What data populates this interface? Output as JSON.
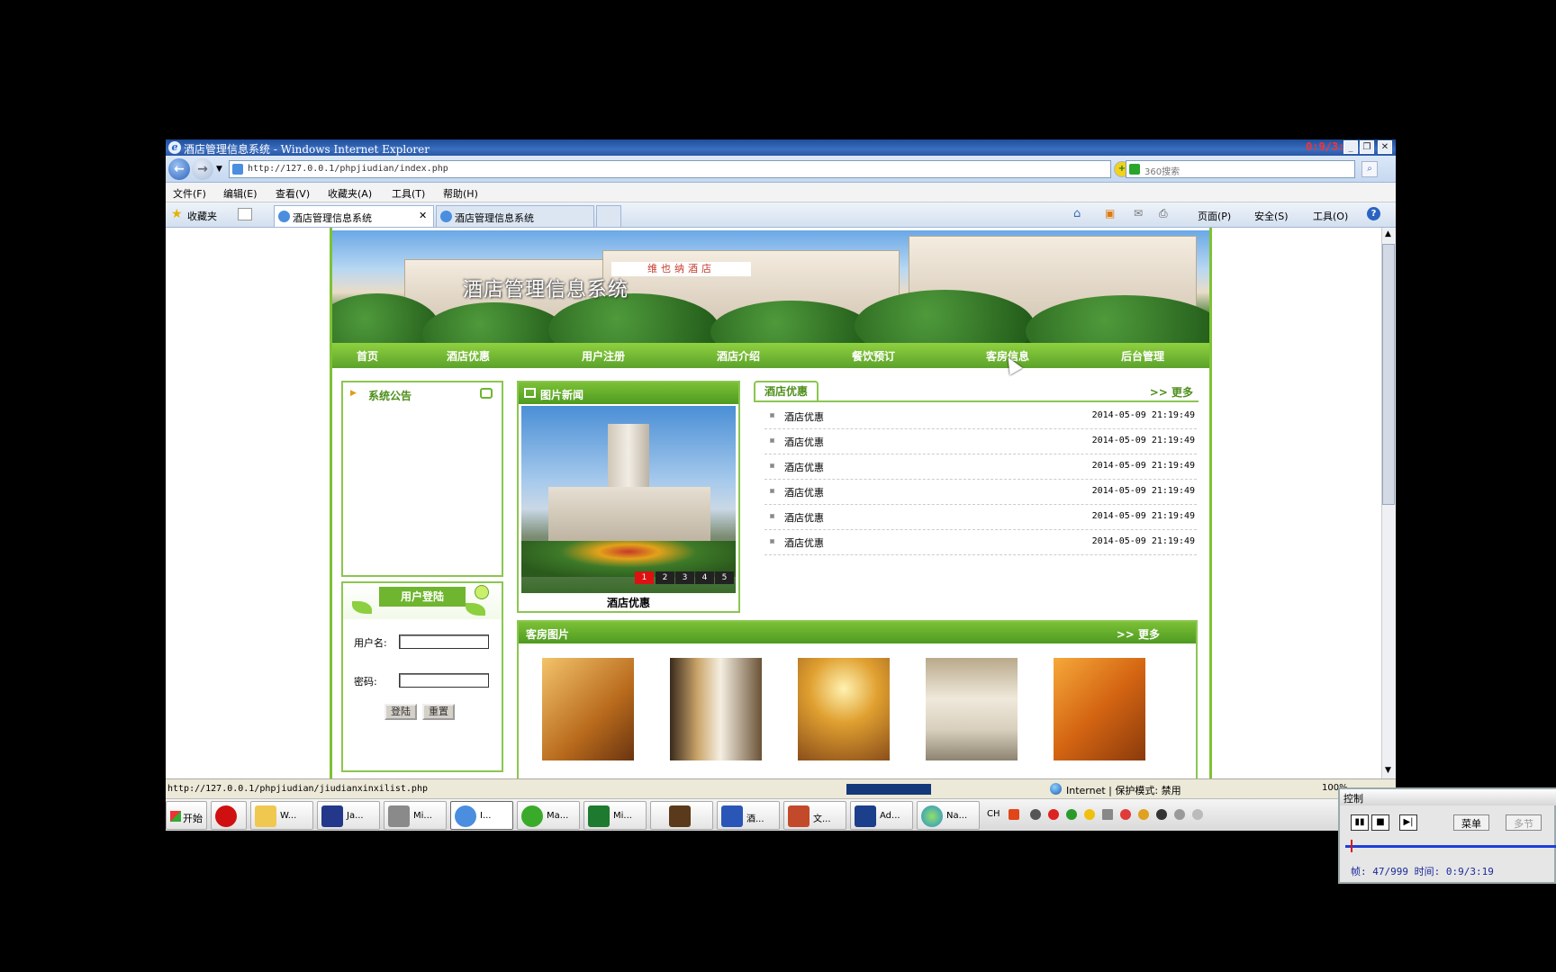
{
  "window": {
    "title": "酒店管理信息系统 - Windows Internet Explorer",
    "recorder_time": "0:9/3:19",
    "buttons": [
      "_",
      "❐",
      "✕"
    ]
  },
  "address": {
    "url": "http://127.0.0.1/phpjiudian/index.php",
    "search_placeholder": "360搜索"
  },
  "menu": [
    "文件(F)",
    "编辑(E)",
    "查看(V)",
    "收藏夹(A)",
    "工具(T)",
    "帮助(H)"
  ],
  "tabs": {
    "favorites": "收藏夹",
    "items": [
      {
        "label": "酒店管理信息系统"
      },
      {
        "label": "酒店管理信息系统"
      }
    ],
    "commands": [
      "页面(P)",
      "安全(S)",
      "工具(O)"
    ]
  },
  "site": {
    "banner_title": "酒店管理信息系统",
    "banner_sign": "维也纳酒店",
    "nav": [
      "首页",
      "酒店优惠",
      "用户注册",
      "酒店介绍",
      "餐饮预订",
      "客房信息",
      "后台管理"
    ],
    "notice_title": "系统公告",
    "login": {
      "title": "用户登陆",
      "username_label": "用户名:",
      "password_label": "密码:",
      "login_button": "登陆",
      "reset_button": "重置"
    },
    "pic_news": {
      "title": "图片新闻",
      "caption": "酒店优惠",
      "pages": [
        "1",
        "2",
        "3",
        "4",
        "5"
      ],
      "active_page": 1
    },
    "promo": {
      "title": "酒店优惠",
      "more": ">> 更多",
      "items": [
        {
          "title": "酒店优惠",
          "date": "2014-05-09 21:19:49"
        },
        {
          "title": "酒店优惠",
          "date": "2014-05-09 21:19:49"
        },
        {
          "title": "酒店优惠",
          "date": "2014-05-09 21:19:49"
        },
        {
          "title": "酒店优惠",
          "date": "2014-05-09 21:19:49"
        },
        {
          "title": "酒店优惠",
          "date": "2014-05-09 21:19:49"
        },
        {
          "title": "酒店优惠",
          "date": "2014-05-09 21:19:49"
        }
      ]
    },
    "rooms": {
      "title": "客房图片",
      "more": ">> 更多"
    }
  },
  "status": {
    "url": "http://127.0.0.1/phpjiudian/jiudianxinxilist.php",
    "zone": "Internet | 保护模式: 禁用",
    "zoom": "100%"
  },
  "taskbar": {
    "start": "开始",
    "items": [
      "W...",
      "Ja...",
      "Mi...",
      "I...",
      "Ma...",
      "Mi...",
      "",
      "酒...",
      "文...",
      "Ad...",
      "Na..."
    ],
    "lang": "CH"
  },
  "control": {
    "title": "控制",
    "menu_button": "菜单",
    "multi_button": "多节",
    "info": "帧: 47/999 时间: 0:9/3:19"
  },
  "colors": {
    "green_accent": "#6fb52f",
    "green_border": "#8bc650",
    "green_text": "#4e8f1c"
  }
}
